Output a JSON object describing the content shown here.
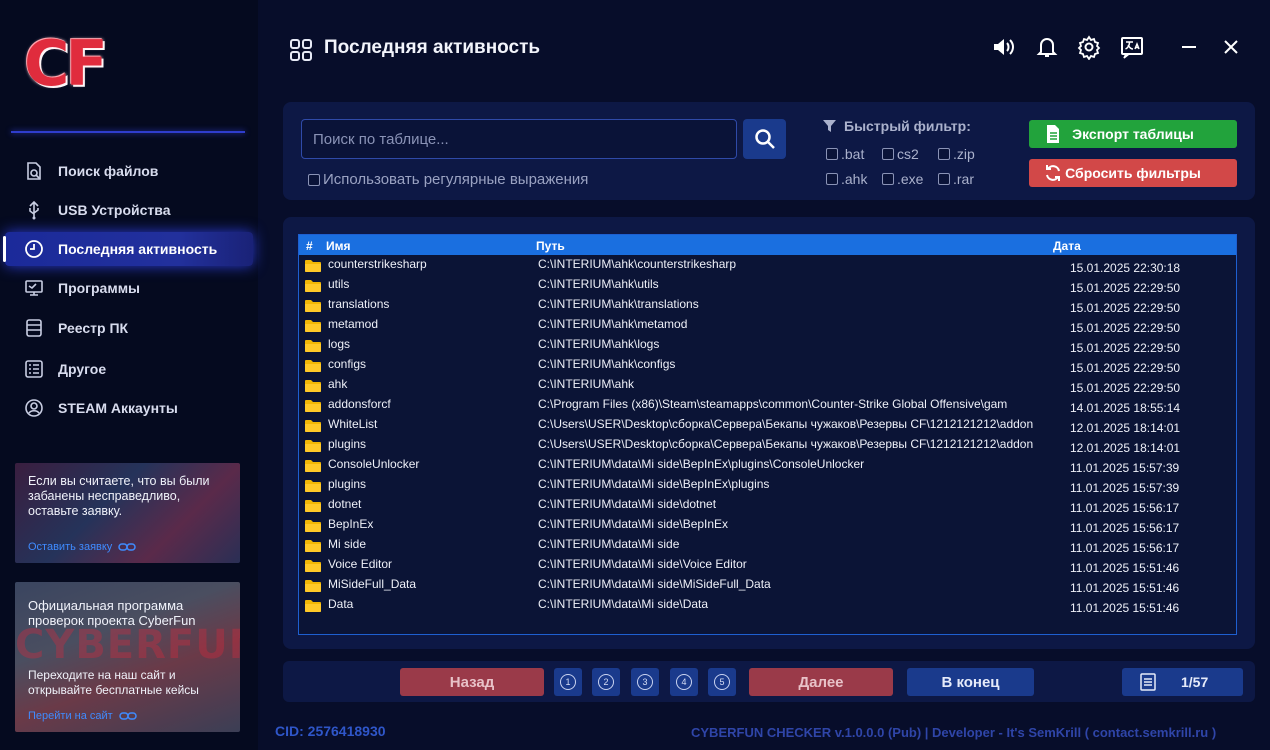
{
  "app": {
    "logo": "CF",
    "title": "Последняя активность"
  },
  "sidebar": {
    "items": [
      {
        "label": "Поиск файлов",
        "icon": "file-search-icon"
      },
      {
        "label": "USB Устройства",
        "icon": "usb-icon"
      },
      {
        "label": "Последняя активность",
        "icon": "clock-icon",
        "active": true
      },
      {
        "label": "Программы",
        "icon": "monitor-icon"
      },
      {
        "label": "Реестр ПК",
        "icon": "registry-icon"
      },
      {
        "label": "Другое",
        "icon": "list-icon"
      },
      {
        "label": "STEAM Аккаунты",
        "icon": "user-circle-icon"
      }
    ],
    "promo1": {
      "text": "Если вы считаете, что вы были забанены несправедливо, оставьте заявку.",
      "link": "Оставить заявку"
    },
    "promo2": {
      "title": "Официальная программа проверок проекта CyberFun",
      "watermark": "CYBERFUN",
      "text": "Переходите на наш сайт и открывайте бесплатные кейсы",
      "link": "Перейти на сайт"
    }
  },
  "header_icons": [
    "volume-icon",
    "bell-icon",
    "gear-icon",
    "translate-icon",
    "minimize-icon",
    "close-icon"
  ],
  "filters": {
    "search_placeholder": "Поиск по таблице...",
    "regex_label": "Использовать регулярные выражения",
    "quick_filter_title": "Быстрый фильтр:",
    "extensions": [
      ".bat",
      "cs2",
      ".zip",
      ".ahk",
      ".exe",
      ".rar"
    ],
    "export_label": "Экспорт таблицы",
    "reset_label": "Сбросить фильтры"
  },
  "table": {
    "headers": {
      "num": "#",
      "name": "Имя",
      "path": "Путь",
      "date": "Дата"
    },
    "rows": [
      {
        "name": "counterstrikesharp",
        "path": "C:\\INTERIUM\\ahk\\counterstrikesharp",
        "date": "15.01.2025 22:30:18"
      },
      {
        "name": "utils",
        "path": "C:\\INTERIUM\\ahk\\utils",
        "date": "15.01.2025 22:29:50"
      },
      {
        "name": "translations",
        "path": "C:\\INTERIUM\\ahk\\translations",
        "date": "15.01.2025 22:29:50"
      },
      {
        "name": "metamod",
        "path": "C:\\INTERIUM\\ahk\\metamod",
        "date": "15.01.2025 22:29:50"
      },
      {
        "name": "logs",
        "path": "C:\\INTERIUM\\ahk\\logs",
        "date": "15.01.2025 22:29:50"
      },
      {
        "name": "configs",
        "path": "C:\\INTERIUM\\ahk\\configs",
        "date": "15.01.2025 22:29:50"
      },
      {
        "name": "ahk",
        "path": "C:\\INTERIUM\\ahk",
        "date": "15.01.2025 22:29:50"
      },
      {
        "name": "addonsforcf",
        "path": "C:\\Program Files (x86)\\Steam\\steamapps\\common\\Counter-Strike Global Offensive\\gam",
        "date": "14.01.2025 18:55:14"
      },
      {
        "name": "WhiteList",
        "path": "C:\\Users\\USER\\Desktop\\сборка\\Сервера\\Бекапы чужаков\\Резервы CF\\1212121212\\addon",
        "date": "12.01.2025 18:14:01"
      },
      {
        "name": "plugins",
        "path": "C:\\Users\\USER\\Desktop\\сборка\\Сервера\\Бекапы чужаков\\Резервы CF\\1212121212\\addon",
        "date": "12.01.2025 18:14:01"
      },
      {
        "name": "ConsoleUnlocker",
        "path": "C:\\INTERIUM\\data\\Mi side\\BepInEx\\plugins\\ConsoleUnlocker",
        "date": "11.01.2025 15:57:39"
      },
      {
        "name": "plugins",
        "path": "C:\\INTERIUM\\data\\Mi side\\BepInEx\\plugins",
        "date": "11.01.2025 15:57:39"
      },
      {
        "name": "dotnet",
        "path": "C:\\INTERIUM\\data\\Mi side\\dotnet",
        "date": "11.01.2025 15:56:17"
      },
      {
        "name": "BepInEx",
        "path": "C:\\INTERIUM\\data\\Mi side\\BepInEx",
        "date": "11.01.2025 15:56:17"
      },
      {
        "name": "Mi side",
        "path": "C:\\INTERIUM\\data\\Mi side",
        "date": "11.01.2025 15:56:17"
      },
      {
        "name": "Voice Editor",
        "path": "C:\\INTERIUM\\data\\Mi side\\Voice Editor",
        "date": "11.01.2025 15:51:46"
      },
      {
        "name": "MiSideFull_Data",
        "path": "C:\\INTERIUM\\data\\Mi side\\MiSideFull_Data",
        "date": "11.01.2025 15:51:46"
      },
      {
        "name": "Data",
        "path": "C:\\INTERIUM\\data\\Mi side\\Data",
        "date": "11.01.2025 15:51:46"
      }
    ]
  },
  "pager": {
    "prev_label": "Назад",
    "pages": [
      "1",
      "2",
      "3",
      "4",
      "5"
    ],
    "next_label": "Далее",
    "end_label": "В конец",
    "count": "1/57"
  },
  "footer": {
    "cid": "CID: 2576418930",
    "credits": "CYBERFUN CHECKER v.1.0.0.0 (Pub) | Developer - It's SemKrill ( contact.semkrill.ru )"
  },
  "colors": {
    "background": "#070d2a",
    "panel": "#0d1845",
    "accent_blue": "#1a6fe0",
    "export_green": "#22a33c",
    "reset_red": "#d24848"
  }
}
